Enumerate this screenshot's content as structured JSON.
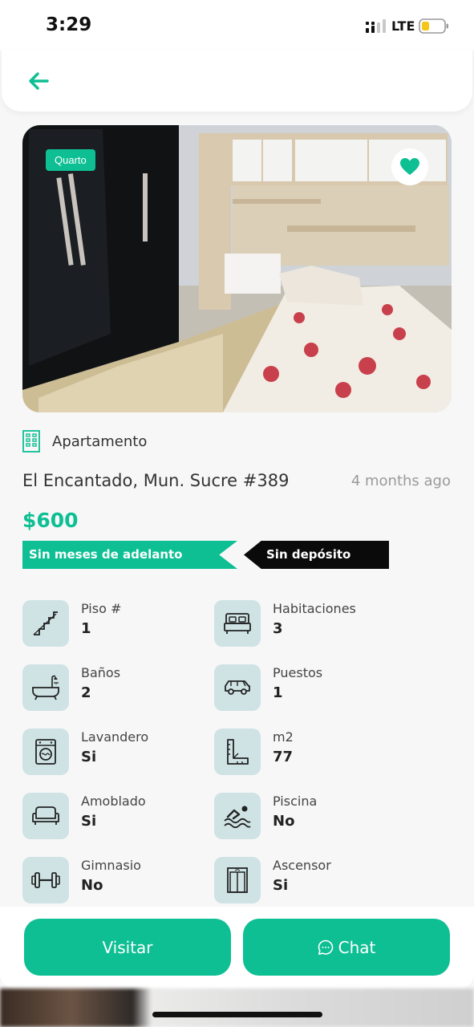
{
  "status": {
    "time": "3:29",
    "network": "LTE"
  },
  "nav": {
    "back_icon": "arrow-left-icon"
  },
  "listing": {
    "badge": "Quarto",
    "property_type": "Apartamento",
    "address": "El Encantado, Mun. Sucre #389",
    "posted": "4 months ago",
    "price": "$600",
    "tags": [
      "Sin meses de adelanto",
      "Sin depósito"
    ]
  },
  "features": [
    {
      "label": "Piso #",
      "value": "1",
      "icon": "stairs-icon"
    },
    {
      "label": "Habitaciones",
      "value": "3",
      "icon": "bed-icon"
    },
    {
      "label": "Baños",
      "value": "2",
      "icon": "bathtub-icon"
    },
    {
      "label": "Puestos",
      "value": "1",
      "icon": "car-icon"
    },
    {
      "label": "Lavandero",
      "value": "Si",
      "icon": "washing-machine-icon"
    },
    {
      "label": "m2",
      "value": "77",
      "icon": "ruler-icon"
    },
    {
      "label": "Amoblado",
      "value": "Si",
      "icon": "sofa-icon"
    },
    {
      "label": "Piscina",
      "value": "No",
      "icon": "pool-icon"
    },
    {
      "label": "Gimnasio",
      "value": "No",
      "icon": "dumbbell-icon"
    },
    {
      "label": "Ascensor",
      "value": "Si",
      "icon": "elevator-icon"
    }
  ],
  "actions": {
    "visit_label": "Visitar",
    "chat_label": "Chat"
  },
  "colors": {
    "accent": "#0dbf93",
    "icon_bg": "#cfe3e4",
    "tag_dark": "#0a0a0a"
  }
}
